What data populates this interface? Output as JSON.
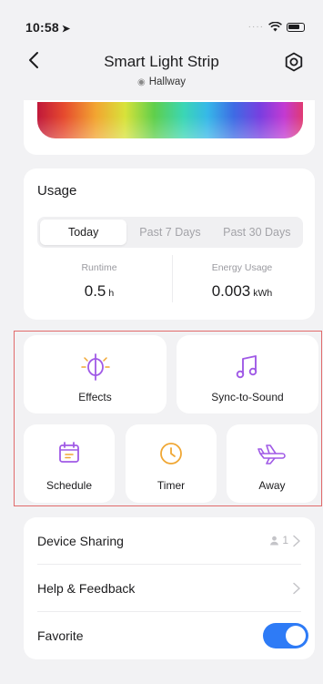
{
  "status_bar": {
    "time": "10:58",
    "location_arrow": "➤"
  },
  "nav": {
    "title": "Smart Light Strip",
    "location": "Hallway"
  },
  "usage": {
    "title": "Usage",
    "tabs": [
      {
        "label": "Today"
      },
      {
        "label": "Past 7 Days"
      },
      {
        "label": "Past 30 Days"
      }
    ],
    "selected_tab": "Today",
    "runtime": {
      "label": "Runtime",
      "value": "0.5",
      "unit": "h"
    },
    "energy": {
      "label": "Energy Usage",
      "value": "0.003",
      "unit": "kWh"
    }
  },
  "features": {
    "effects": {
      "label": "Effects",
      "icon": "effects-icon"
    },
    "sync": {
      "label": "Sync-to-Sound",
      "icon": "music-note-icon"
    },
    "schedule": {
      "label": "Schedule",
      "icon": "calendar-icon"
    },
    "timer": {
      "label": "Timer",
      "icon": "clock-icon"
    },
    "away": {
      "label": "Away",
      "icon": "airplane-icon"
    }
  },
  "settings": {
    "device_sharing": {
      "label": "Device Sharing",
      "count": "1"
    },
    "help": {
      "label": "Help & Feedback"
    },
    "favorite": {
      "label": "Favorite",
      "enabled": true
    }
  },
  "colors": {
    "accent_purple": "#a05ae6",
    "accent_orange": "#f0a734",
    "toggle_blue": "#2e7bf6",
    "highlight_red": "#e16b6b"
  }
}
